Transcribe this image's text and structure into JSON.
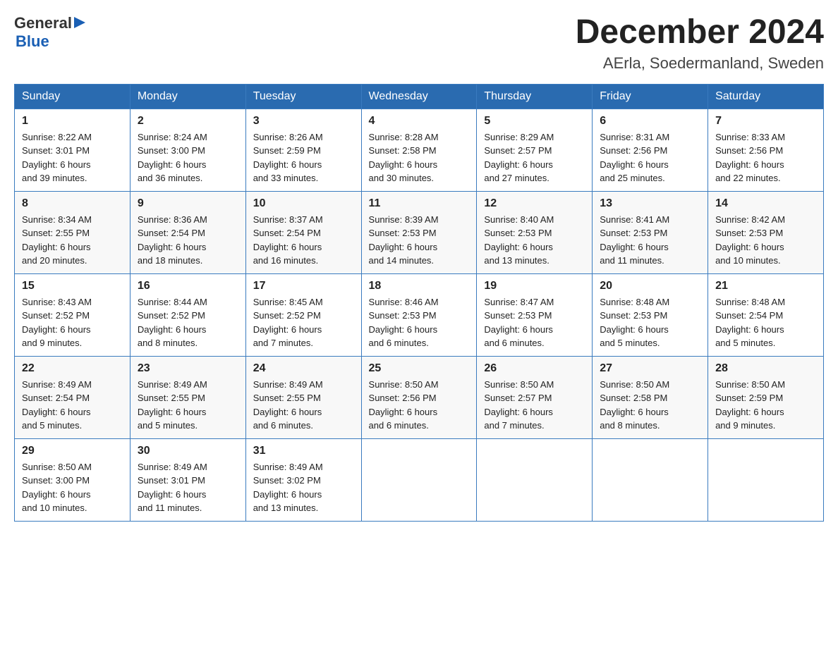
{
  "header": {
    "logo_general": "General",
    "logo_blue": "Blue",
    "title": "December 2024",
    "subtitle": "AErla, Soedermanland, Sweden"
  },
  "weekdays": [
    "Sunday",
    "Monday",
    "Tuesday",
    "Wednesday",
    "Thursday",
    "Friday",
    "Saturday"
  ],
  "weeks": [
    [
      {
        "day": "1",
        "sunrise": "8:22 AM",
        "sunset": "3:01 PM",
        "daylight": "6 hours and 39 minutes."
      },
      {
        "day": "2",
        "sunrise": "8:24 AM",
        "sunset": "3:00 PM",
        "daylight": "6 hours and 36 minutes."
      },
      {
        "day": "3",
        "sunrise": "8:26 AM",
        "sunset": "2:59 PM",
        "daylight": "6 hours and 33 minutes."
      },
      {
        "day": "4",
        "sunrise": "8:28 AM",
        "sunset": "2:58 PM",
        "daylight": "6 hours and 30 minutes."
      },
      {
        "day": "5",
        "sunrise": "8:29 AM",
        "sunset": "2:57 PM",
        "daylight": "6 hours and 27 minutes."
      },
      {
        "day": "6",
        "sunrise": "8:31 AM",
        "sunset": "2:56 PM",
        "daylight": "6 hours and 25 minutes."
      },
      {
        "day": "7",
        "sunrise": "8:33 AM",
        "sunset": "2:56 PM",
        "daylight": "6 hours and 22 minutes."
      }
    ],
    [
      {
        "day": "8",
        "sunrise": "8:34 AM",
        "sunset": "2:55 PM",
        "daylight": "6 hours and 20 minutes."
      },
      {
        "day": "9",
        "sunrise": "8:36 AM",
        "sunset": "2:54 PM",
        "daylight": "6 hours and 18 minutes."
      },
      {
        "day": "10",
        "sunrise": "8:37 AM",
        "sunset": "2:54 PM",
        "daylight": "6 hours and 16 minutes."
      },
      {
        "day": "11",
        "sunrise": "8:39 AM",
        "sunset": "2:53 PM",
        "daylight": "6 hours and 14 minutes."
      },
      {
        "day": "12",
        "sunrise": "8:40 AM",
        "sunset": "2:53 PM",
        "daylight": "6 hours and 13 minutes."
      },
      {
        "day": "13",
        "sunrise": "8:41 AM",
        "sunset": "2:53 PM",
        "daylight": "6 hours and 11 minutes."
      },
      {
        "day": "14",
        "sunrise": "8:42 AM",
        "sunset": "2:53 PM",
        "daylight": "6 hours and 10 minutes."
      }
    ],
    [
      {
        "day": "15",
        "sunrise": "8:43 AM",
        "sunset": "2:52 PM",
        "daylight": "6 hours and 9 minutes."
      },
      {
        "day": "16",
        "sunrise": "8:44 AM",
        "sunset": "2:52 PM",
        "daylight": "6 hours and 8 minutes."
      },
      {
        "day": "17",
        "sunrise": "8:45 AM",
        "sunset": "2:52 PM",
        "daylight": "6 hours and 7 minutes."
      },
      {
        "day": "18",
        "sunrise": "8:46 AM",
        "sunset": "2:53 PM",
        "daylight": "6 hours and 6 minutes."
      },
      {
        "day": "19",
        "sunrise": "8:47 AM",
        "sunset": "2:53 PM",
        "daylight": "6 hours and 6 minutes."
      },
      {
        "day": "20",
        "sunrise": "8:48 AM",
        "sunset": "2:53 PM",
        "daylight": "6 hours and 5 minutes."
      },
      {
        "day": "21",
        "sunrise": "8:48 AM",
        "sunset": "2:54 PM",
        "daylight": "6 hours and 5 minutes."
      }
    ],
    [
      {
        "day": "22",
        "sunrise": "8:49 AM",
        "sunset": "2:54 PM",
        "daylight": "6 hours and 5 minutes."
      },
      {
        "day": "23",
        "sunrise": "8:49 AM",
        "sunset": "2:55 PM",
        "daylight": "6 hours and 5 minutes."
      },
      {
        "day": "24",
        "sunrise": "8:49 AM",
        "sunset": "2:55 PM",
        "daylight": "6 hours and 6 minutes."
      },
      {
        "day": "25",
        "sunrise": "8:50 AM",
        "sunset": "2:56 PM",
        "daylight": "6 hours and 6 minutes."
      },
      {
        "day": "26",
        "sunrise": "8:50 AM",
        "sunset": "2:57 PM",
        "daylight": "6 hours and 7 minutes."
      },
      {
        "day": "27",
        "sunrise": "8:50 AM",
        "sunset": "2:58 PM",
        "daylight": "6 hours and 8 minutes."
      },
      {
        "day": "28",
        "sunrise": "8:50 AM",
        "sunset": "2:59 PM",
        "daylight": "6 hours and 9 minutes."
      }
    ],
    [
      {
        "day": "29",
        "sunrise": "8:50 AM",
        "sunset": "3:00 PM",
        "daylight": "6 hours and 10 minutes."
      },
      {
        "day": "30",
        "sunrise": "8:49 AM",
        "sunset": "3:01 PM",
        "daylight": "6 hours and 11 minutes."
      },
      {
        "day": "31",
        "sunrise": "8:49 AM",
        "sunset": "3:02 PM",
        "daylight": "6 hours and 13 minutes."
      },
      null,
      null,
      null,
      null
    ]
  ],
  "labels": {
    "sunrise": "Sunrise:",
    "sunset": "Sunset:",
    "daylight": "Daylight:"
  }
}
